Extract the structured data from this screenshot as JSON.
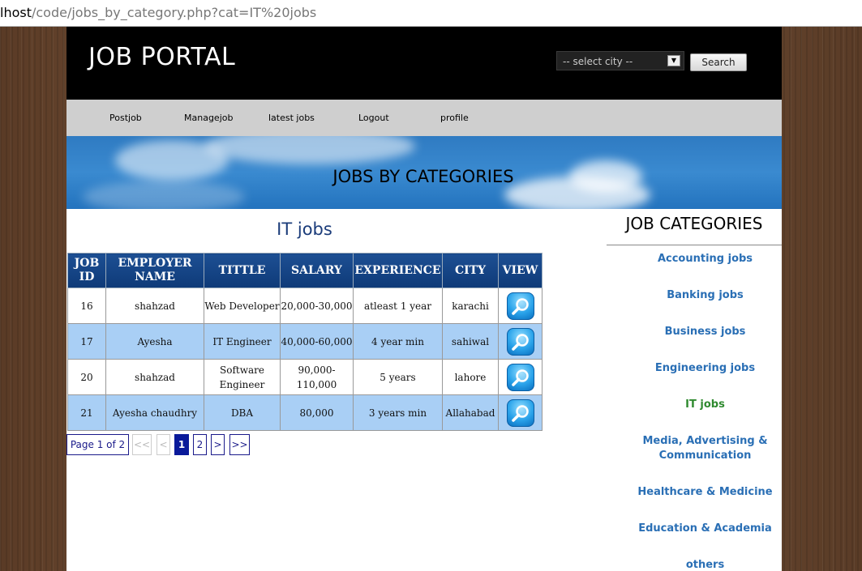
{
  "browser": {
    "url_host": "lhost",
    "url_path": "/code/jobs_by_category.php?cat=IT%20jobs"
  },
  "header": {
    "logo": "JOB PORTAL",
    "city_select_value": "-- select city --",
    "search_label": "Search"
  },
  "nav": {
    "items": [
      "Postjob",
      "Managejob",
      "latest jobs",
      "Logout",
      "profile"
    ]
  },
  "banner": {
    "title": "JOBS BY CATEGORIES"
  },
  "main": {
    "heading": "IT jobs",
    "table": {
      "headers": [
        "JOB ID",
        "EMPLOYER NAME",
        "TITTLE",
        "SALARY",
        "EXPERIENCE",
        "CITY",
        "VIEW"
      ],
      "rows": [
        {
          "id": "16",
          "employer": "shahzad",
          "title": "Web Developer",
          "salary": "20,000-30,000",
          "experience": "atleast 1 year",
          "city": "karachi"
        },
        {
          "id": "17",
          "employer": "Ayesha",
          "title": "IT Engineer",
          "salary": "40,000-60,000",
          "experience": "4 year min",
          "city": "sahiwal"
        },
        {
          "id": "20",
          "employer": "shahzad",
          "title": "Software Engineer",
          "salary": "90,000-110,000",
          "experience": "5 years",
          "city": "lahore"
        },
        {
          "id": "21",
          "employer": "Ayesha chaudhry",
          "title": "DBA",
          "salary": "80,000",
          "experience": "3 years min",
          "city": "Allahabad"
        }
      ]
    },
    "pagination": {
      "info": "Page 1 of 2",
      "first": "<<",
      "prev": "<",
      "pages": [
        "1",
        "2"
      ],
      "current_page": "1",
      "next": ">",
      "last": ">>"
    }
  },
  "sidebar": {
    "title": "JOB CATEGORIES",
    "active_category": "IT jobs",
    "categories": [
      "Accounting jobs",
      "Banking jobs",
      "Business jobs",
      "Engineering jobs",
      "IT jobs",
      "Media, Advertising & Communication",
      "Healthcare & Medicine",
      "Education & Academia",
      "others"
    ]
  },
  "colors": {
    "header_bg": "#000000",
    "nav_bg": "#cfcfcf",
    "table_header": "#0e3a78",
    "row_alt": "#a9cff5",
    "category_link": "#2a6fb5",
    "category_active": "#2f8a2f",
    "pager_current": "#0a1a9a"
  }
}
